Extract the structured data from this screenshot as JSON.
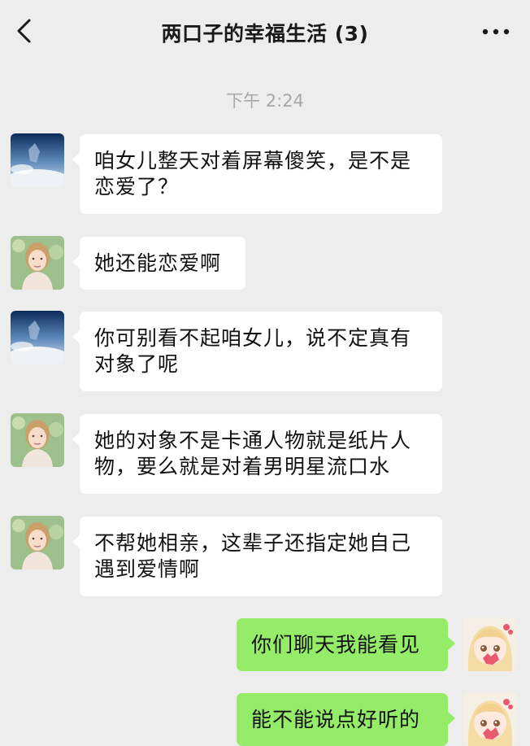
{
  "header": {
    "title": "两口子的幸福生活 (3)",
    "back_icon": "chevron-left-icon",
    "more_icon": "more-dots-icon"
  },
  "timestamp": "下午 2:24",
  "messages": [
    {
      "side": "left",
      "avatar": "landscape",
      "text": "咱女儿整天对着屏幕傻笑，是不是恋爱了？"
    },
    {
      "side": "left",
      "avatar": "woman",
      "text": "她还能恋爱啊"
    },
    {
      "side": "left",
      "avatar": "landscape",
      "text": "你可别看不起咱女儿，说不定真有对象了呢"
    },
    {
      "side": "left",
      "avatar": "woman",
      "text": "她的对象不是卡通人物就是纸片人物，要么就是对着男明星流口水"
    },
    {
      "side": "left",
      "avatar": "woman",
      "text": "不帮她相亲，这辈子还指定她自己遇到爱情啊"
    },
    {
      "side": "right",
      "avatar": "anime",
      "text": "你们聊天我能看见"
    },
    {
      "side": "right",
      "avatar": "anime",
      "text": "能不能说点好听的"
    }
  ],
  "colors": {
    "background": "#ededed",
    "bubble_left": "#ffffff",
    "bubble_right": "#95ec69",
    "timestamp": "#a8a8a8"
  }
}
